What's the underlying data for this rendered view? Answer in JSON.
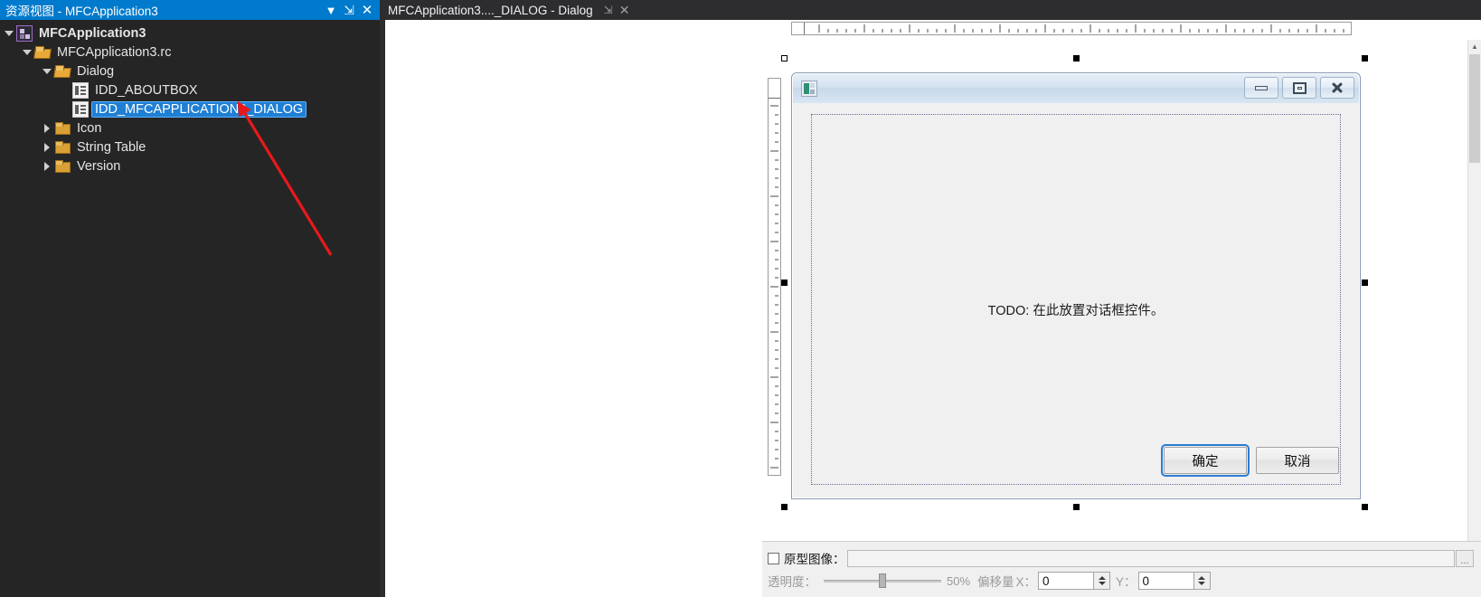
{
  "resource_view": {
    "header_title": "资源视图 - MFCApplication3",
    "header_buttons": [
      {
        "name": "dropdown",
        "glyph": "▼"
      },
      {
        "name": "pin",
        "glyph": "⇲"
      },
      {
        "name": "close",
        "glyph": "✕"
      }
    ],
    "tree": [
      {
        "label": "MFCApplication3",
        "icon": "project-icon",
        "twisty": "open",
        "indent": 0,
        "bold": true,
        "selected": false
      },
      {
        "label": "MFCApplication3.rc",
        "icon": "folder-open-icon",
        "twisty": "open",
        "indent": 20,
        "bold": false,
        "selected": false
      },
      {
        "label": "Dialog",
        "icon": "folder-open-icon",
        "twisty": "open",
        "indent": 40,
        "bold": false,
        "selected": false
      },
      {
        "label": "IDD_ABOUTBOX",
        "icon": "dialog-res-icon",
        "twisty": "none",
        "indent": 78,
        "bold": false,
        "selected": false
      },
      {
        "label": "IDD_MFCAPPLICATION3_DIALOG",
        "icon": "dialog-res-icon",
        "twisty": "none",
        "indent": 78,
        "bold": false,
        "selected": true
      },
      {
        "label": "Icon",
        "icon": "folder-icon",
        "twisty": "closed",
        "indent": 40,
        "bold": false,
        "selected": false
      },
      {
        "label": "String Table",
        "icon": "folder-icon",
        "twisty": "closed",
        "indent": 40,
        "bold": false,
        "selected": false
      },
      {
        "label": "Version",
        "icon": "folder-icon",
        "twisty": "closed",
        "indent": 40,
        "bold": false,
        "selected": false
      }
    ],
    "annotation": {
      "name": "red-arrow",
      "color": "#e8191b"
    }
  },
  "editor": {
    "tab": {
      "title": "MFCApplication3...._DIALOG - Dialog",
      "pin_glyph": "⇲",
      "close_glyph": "✕"
    },
    "dialog": {
      "title": "",
      "app_icon": "mfc-app-icon",
      "system_buttons": [
        {
          "name": "minimize-button",
          "glyph": "minimize"
        },
        {
          "name": "maximize-button",
          "glyph": "maximize"
        },
        {
          "name": "close-button",
          "glyph": "close"
        }
      ],
      "todo_text": "TODO: 在此放置对话框控件。",
      "buttons": [
        {
          "label": "确定",
          "default": true
        },
        {
          "label": "取消",
          "default": false
        }
      ]
    },
    "proto_bar": {
      "checkbox_checked": false,
      "image_label": "原型图像：",
      "image_path": "",
      "transparency_label": "透明度：",
      "transparency_percent": "50%",
      "transparency_value": 50,
      "offset_label": "偏移量",
      "offset_x_label": "X：",
      "offset_x_value": "0",
      "offset_y_label": "Y：",
      "offset_y_value": "0"
    }
  },
  "colors": {
    "vs_blue": "#007acc",
    "panel_dark": "#252526",
    "tab_dark": "#2d2d30",
    "selection_blue": "#1f7fd4",
    "annotation_red": "#e8191b",
    "default_btn_focus": "#2c7bd4"
  }
}
